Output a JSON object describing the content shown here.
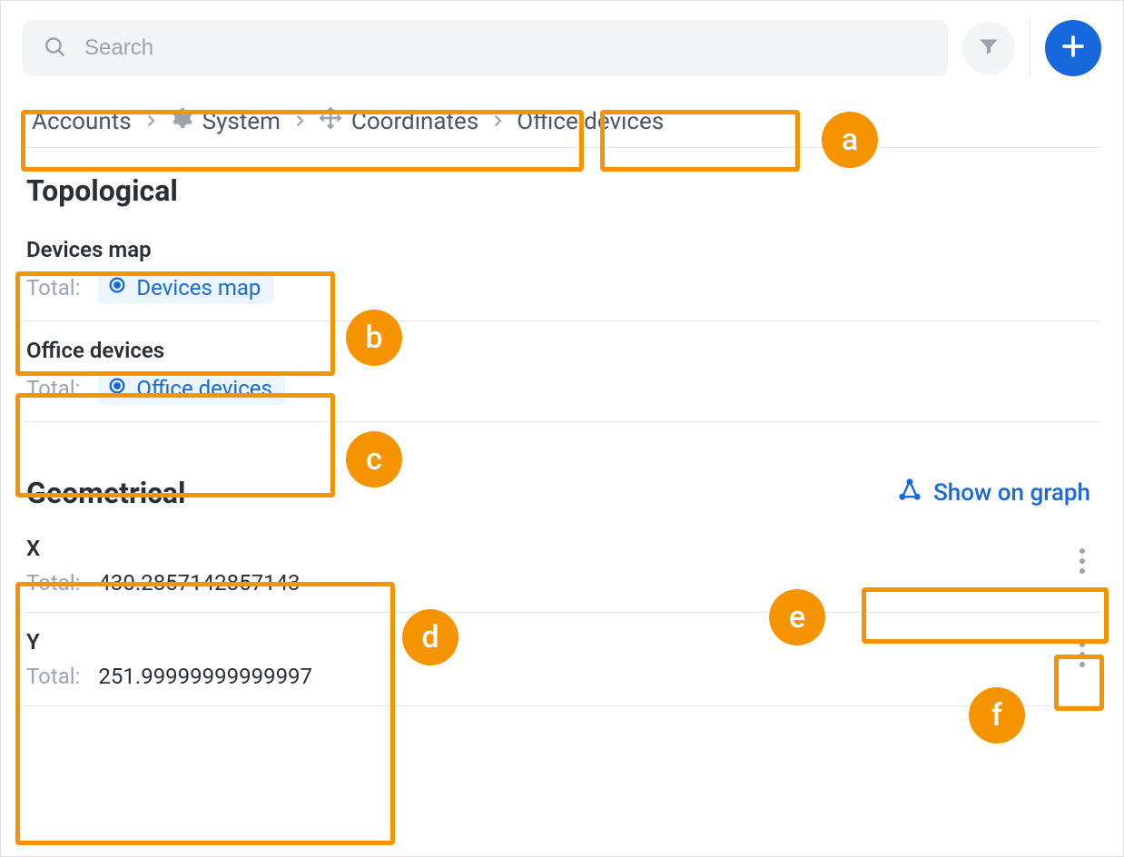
{
  "search": {
    "placeholder": "Search"
  },
  "breadcrumb": {
    "items": [
      {
        "label": "Accounts",
        "icon": null
      },
      {
        "label": "System",
        "icon": "gear"
      },
      {
        "label": "Coordinates",
        "icon": "move"
      },
      {
        "label": "Office devices",
        "icon": null
      }
    ]
  },
  "sections": {
    "topological": {
      "title": "Topological",
      "entries": [
        {
          "title": "Devices map",
          "total_label": "Total:",
          "pill_label": "Devices map"
        },
        {
          "title": "Office devices",
          "total_label": "Total:",
          "pill_label": "Office devices"
        }
      ]
    },
    "geometrical": {
      "title": "Geometrical",
      "show_graph_label": "Show on graph",
      "entries": [
        {
          "title": "X",
          "total_label": "Total:",
          "value": "430.2857142857143"
        },
        {
          "title": "Y",
          "total_label": "Total:",
          "value": "251.99999999999997"
        }
      ]
    }
  },
  "annotations": {
    "a": "a",
    "b": "b",
    "c": "c",
    "d": "d",
    "e": "e",
    "f": "f"
  },
  "colors": {
    "accent": "#1668dc",
    "highlight": "#f59300"
  }
}
